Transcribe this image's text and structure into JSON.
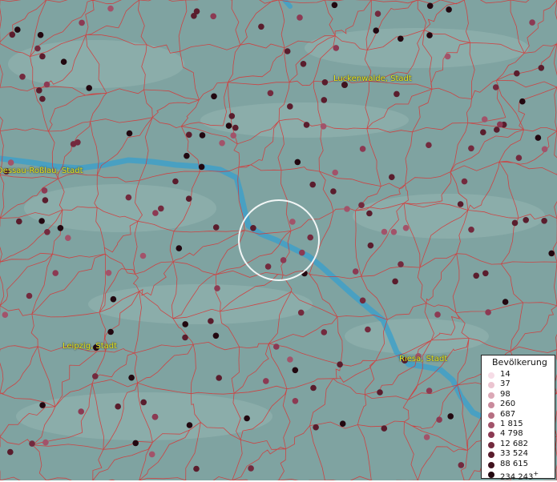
{
  "map": {
    "cities": [
      {
        "name": "Luckenwalde, Stadt",
        "id": "luckenwalde"
      },
      {
        "name": "Dessau-Roßlau, Stadt",
        "id": "dessau"
      },
      {
        "name": "Leipzig, Stadt",
        "id": "leipzig"
      },
      {
        "name": "Riesa, Stadt",
        "id": "riesa"
      }
    ],
    "colors": {
      "land": "#7fa3a1",
      "river": "#3fa0c8",
      "borders": "#d43a3a",
      "label": "#e6e61a"
    }
  },
  "legend": {
    "title": "Bevölkerung",
    "entries": [
      {
        "value": "14",
        "color": "#f6dce6"
      },
      {
        "value": "37",
        "color": "#ebc4d0"
      },
      {
        "value": "98",
        "color": "#dba8b6"
      },
      {
        "value": "260",
        "color": "#c98a9c"
      },
      {
        "value": "687",
        "color": "#b66f82"
      },
      {
        "value": "1 815",
        "color": "#a2536a"
      },
      {
        "value": "4 798",
        "color": "#8c3a53"
      },
      {
        "value": "12 682",
        "color": "#732a3e"
      },
      {
        "value": "33 524",
        "color": "#5a1d2d"
      },
      {
        "value": "88 615",
        "color": "#40121e"
      },
      {
        "value": "234 243",
        "color": "#220810"
      }
    ],
    "overflow_mark": "+"
  }
}
